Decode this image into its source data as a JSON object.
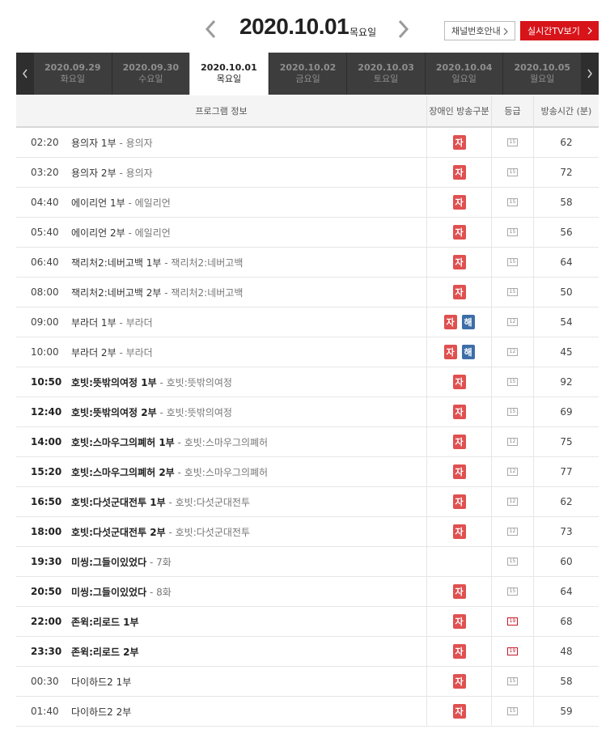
{
  "header": {
    "date": "2020.10.01",
    "weekday": "목요일",
    "channel_guide_label": "채널번호안내",
    "live_tv_label": "실시간TV보기",
    "prev_icon": "chevron-left-icon",
    "next_icon": "chevron-right-icon"
  },
  "date_strip": [
    {
      "date": "2020.09.29",
      "weekday": "화요일"
    },
    {
      "date": "2020.09.30",
      "weekday": "수요일"
    },
    {
      "date": "2020.10.01",
      "weekday": "목요일"
    },
    {
      "date": "2020.10.02",
      "weekday": "금요일"
    },
    {
      "date": "2020.10.03",
      "weekday": "토요일"
    },
    {
      "date": "2020.10.04",
      "weekday": "일요일"
    },
    {
      "date": "2020.10.05",
      "weekday": "월요일"
    }
  ],
  "active_date": "2020.10.01",
  "table": {
    "columns": [
      "프로그램 정보",
      "장애인 방송구분",
      "등급",
      "방송시간 (분)"
    ],
    "rows": [
      {
        "time": "02:20",
        "title": "용의자 1부",
        "sub": " - 용의자",
        "badges": [
          "자"
        ],
        "grade": "15",
        "duration": "62",
        "bold": false
      },
      {
        "time": "03:20",
        "title": "용의자 2부",
        "sub": " - 용의자",
        "badges": [
          "자"
        ],
        "grade": "15",
        "duration": "72",
        "bold": false
      },
      {
        "time": "04:40",
        "title": "에이리언 1부",
        "sub": " - 에일리언",
        "badges": [
          "자"
        ],
        "grade": "15",
        "duration": "58",
        "bold": false
      },
      {
        "time": "05:40",
        "title": "에이리언 2부",
        "sub": " - 에일리언",
        "badges": [
          "자"
        ],
        "grade": "15",
        "duration": "56",
        "bold": false
      },
      {
        "time": "06:40",
        "title": "잭리처2:네버고백 1부",
        "sub": " - 잭리처2:네버고백",
        "badges": [
          "자"
        ],
        "grade": "15",
        "duration": "64",
        "bold": false
      },
      {
        "time": "08:00",
        "title": "잭리처2:네버고백 2부",
        "sub": " - 잭리처2:네버고백",
        "badges": [
          "자"
        ],
        "grade": "15",
        "duration": "50",
        "bold": false
      },
      {
        "time": "09:00",
        "title": "부라더 1부",
        "sub": " - 부라더",
        "badges": [
          "자",
          "해"
        ],
        "grade": "12",
        "duration": "54",
        "bold": false
      },
      {
        "time": "10:00",
        "title": "부라더 2부",
        "sub": " - 부라더",
        "badges": [
          "자",
          "해"
        ],
        "grade": "12",
        "duration": "45",
        "bold": false
      },
      {
        "time": "10:50",
        "title": "호빗:뜻밖의여정 1부",
        "sub": " - 호빗:뜻밖의여정",
        "badges": [
          "자"
        ],
        "grade": "15",
        "duration": "92",
        "bold": true
      },
      {
        "time": "12:40",
        "title": "호빗:뜻밖의여정 2부",
        "sub": " - 호빗:뜻밖의여정",
        "badges": [
          "자"
        ],
        "grade": "15",
        "duration": "69",
        "bold": true
      },
      {
        "time": "14:00",
        "title": "호빗:스마우그의폐허 1부",
        "sub": " - 호빗:스마우그의폐허",
        "badges": [
          "자"
        ],
        "grade": "12",
        "duration": "75",
        "bold": true
      },
      {
        "time": "15:20",
        "title": "호빗:스마우그의폐허 2부",
        "sub": " - 호빗:스마우그의폐허",
        "badges": [
          "자"
        ],
        "grade": "12",
        "duration": "77",
        "bold": true
      },
      {
        "time": "16:50",
        "title": "호빗:다섯군대전투 1부",
        "sub": " - 호빗:다섯군대전투",
        "badges": [
          "자"
        ],
        "grade": "12",
        "duration": "62",
        "bold": true
      },
      {
        "time": "18:00",
        "title": "호빗:다섯군대전투 2부",
        "sub": " - 호빗:다섯군대전투",
        "badges": [
          "자"
        ],
        "grade": "12",
        "duration": "73",
        "bold": true
      },
      {
        "time": "19:30",
        "title": "미씽:그들이있었다",
        "sub": " - 7화",
        "badges": [],
        "grade": "15",
        "duration": "60",
        "bold": true
      },
      {
        "time": "20:50",
        "title": "미씽:그들이있었다",
        "sub": " - 8화",
        "badges": [
          "자"
        ],
        "grade": "15",
        "duration": "64",
        "bold": true
      },
      {
        "time": "22:00",
        "title": "존윅:리로드 1부",
        "sub": "",
        "badges": [
          "자"
        ],
        "grade": "19",
        "duration": "68",
        "bold": true
      },
      {
        "time": "23:30",
        "title": "존윅:리로드 2부",
        "sub": "",
        "badges": [
          "자"
        ],
        "grade": "19",
        "duration": "48",
        "bold": true
      },
      {
        "time": "00:30",
        "title": "다이하드2 1부",
        "sub": "",
        "badges": [
          "자"
        ],
        "grade": "15",
        "duration": "58",
        "bold": false
      },
      {
        "time": "01:40",
        "title": "다이하드2 2부",
        "sub": "",
        "badges": [
          "자"
        ],
        "grade": "15",
        "duration": "59",
        "bold": false
      }
    ]
  },
  "colors": {
    "accent_red": "#d7141a",
    "badge_ja": "#e05050",
    "badge_hae": "#3e6ea8",
    "strip_bg": "#3d3d3d",
    "grade_19": "#c4192a"
  }
}
